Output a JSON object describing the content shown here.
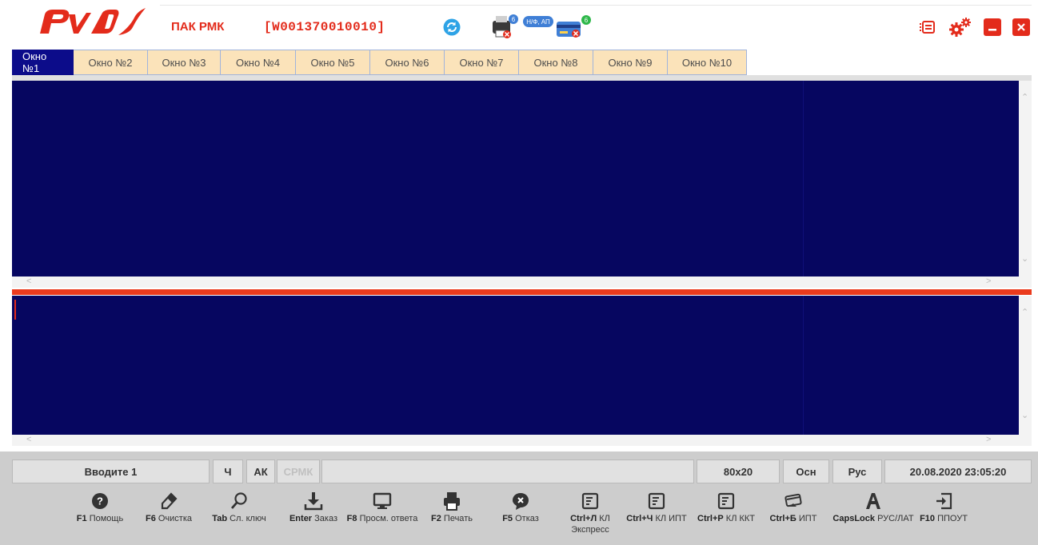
{
  "header": {
    "title": "ПАК РМК",
    "terminal_id": "[W001370010010]",
    "printer_badge": "6",
    "card_badge": "6",
    "card_tag": "Н/Ф, АП"
  },
  "tabs": [
    "Окно №1",
    "Окно №2",
    "Окно №3",
    "Окно №4",
    "Окно №5",
    "Окно №6",
    "Окно №7",
    "Окно №8",
    "Окно №9",
    "Окно №10"
  ],
  "status": {
    "prompt": "Вводите 1",
    "mode_ch": "Ч",
    "mode_ak": "АК",
    "mode_crmk": "СРМК",
    "size": "80x20",
    "osn": "Осн",
    "lang": "Рус",
    "datetime": "20.08.2020 23:05:20"
  },
  "fkeys": [
    {
      "key": "F1",
      "label": "Помощь",
      "icon": "help-icon"
    },
    {
      "key": "F6",
      "label": "Очистка",
      "icon": "eraser-icon"
    },
    {
      "key": "Tab",
      "label": "Сл. ключ",
      "icon": "search-icon"
    },
    {
      "key": "Enter",
      "label": "Заказ",
      "icon": "download-icon"
    },
    {
      "key": "F8",
      "label": "Просм. ответа",
      "icon": "monitor-icon"
    },
    {
      "key": "F2",
      "label": "Печать",
      "icon": "printer-icon"
    },
    {
      "key": "F5",
      "label": "Отказ",
      "icon": "reject-icon"
    },
    {
      "key": "Ctrl+Л",
      "label": "КЛ Экспресс",
      "icon": "document-icon"
    },
    {
      "key": "Ctrl+Ч",
      "label": "КЛ ИПТ",
      "icon": "document-icon"
    },
    {
      "key": "Ctrl+Р",
      "label": "КЛ ККТ",
      "icon": "document-icon"
    },
    {
      "key": "Ctrl+Б",
      "label": "ИПТ",
      "icon": "card-icon"
    },
    {
      "key": "CapsLock",
      "label": "РУС/ЛАТ",
      "icon": "letter-a-icon"
    },
    {
      "key": "F10",
      "label": "ППОУТ",
      "icon": "login-icon"
    }
  ],
  "colors": {
    "brand_red": "#e32b1b",
    "terminal_bg": "#060660",
    "tab_active": "#0c0c8a",
    "tab_bg": "#fbe3ba"
  }
}
